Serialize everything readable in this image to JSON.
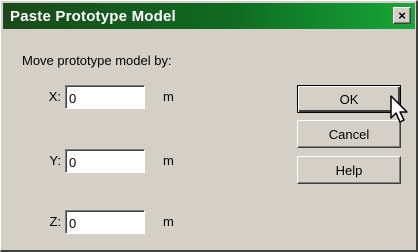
{
  "window": {
    "title": "Paste Prototype Model",
    "close_glyph": "×"
  },
  "form": {
    "prompt": "Move prototype model by:",
    "fields": [
      {
        "label": "X:",
        "value": "0",
        "unit": "m"
      },
      {
        "label": "Y:",
        "value": "0",
        "unit": "m"
      },
      {
        "label": "Z:",
        "value": "0",
        "unit": "m"
      }
    ]
  },
  "buttons": {
    "ok": "OK",
    "cancel": "Cancel",
    "help": "Help"
  },
  "icons": {
    "close": "close-icon",
    "pointer": "mouse-pointer-icon"
  },
  "colors": {
    "titlebar_dark": "#1a4a1a",
    "titlebar_light": "#17a838",
    "face": "#d4d0c8"
  }
}
